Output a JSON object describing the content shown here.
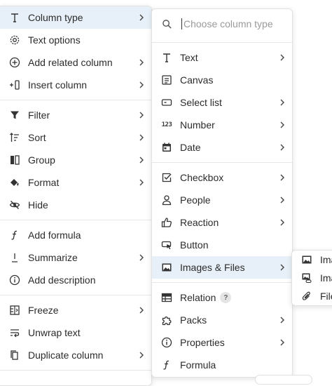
{
  "menu1": {
    "items": [
      {
        "label": "Column type",
        "icon": "column-type-icon"
      },
      {
        "label": "Text options",
        "icon": "gear-icon"
      },
      {
        "label": "Add related column",
        "icon": "plus-circle-icon"
      },
      {
        "label": "Insert column",
        "icon": "insert-column-icon"
      },
      {
        "label": "Filter",
        "icon": "filter-icon"
      },
      {
        "label": "Sort",
        "icon": "sort-icon"
      },
      {
        "label": "Group",
        "icon": "group-icon"
      },
      {
        "label": "Format",
        "icon": "paint-bucket-icon"
      },
      {
        "label": "Hide",
        "icon": "eye-slash-icon"
      },
      {
        "label": "Add formula",
        "icon": "formula-icon"
      },
      {
        "label": "Summarize",
        "icon": "summarize-icon"
      },
      {
        "label": "Add description",
        "icon": "info-icon"
      },
      {
        "label": "Freeze",
        "icon": "freeze-icon"
      },
      {
        "label": "Unwrap text",
        "icon": "unwrap-text-icon"
      },
      {
        "label": "Duplicate column",
        "icon": "duplicate-icon"
      }
    ]
  },
  "menu2": {
    "search_placeholder": "Choose column type",
    "items": [
      {
        "label": "Text",
        "icon": "text-icon"
      },
      {
        "label": "Canvas",
        "icon": "canvas-icon"
      },
      {
        "label": "Select list",
        "icon": "select-list-icon"
      },
      {
        "label": "Number",
        "icon": "number-icon",
        "glyph": "123"
      },
      {
        "label": "Date",
        "icon": "calendar-icon"
      },
      {
        "label": "Checkbox",
        "icon": "checkbox-icon"
      },
      {
        "label": "People",
        "icon": "person-icon"
      },
      {
        "label": "Reaction",
        "icon": "thumbs-up-icon"
      },
      {
        "label": "Button",
        "icon": "button-icon"
      },
      {
        "label": "Images & Files",
        "icon": "image-icon"
      },
      {
        "label": "Relation",
        "icon": "table-icon",
        "badge": "?"
      },
      {
        "label": "Packs",
        "icon": "puzzle-icon"
      },
      {
        "label": "Properties",
        "icon": "info-icon"
      },
      {
        "label": "Formula",
        "icon": "formula-icon"
      }
    ]
  },
  "menu3": {
    "items": [
      {
        "label": "Ima",
        "icon": "image-icon"
      },
      {
        "label": "Ima",
        "icon": "image-link-icon"
      },
      {
        "label": "File",
        "icon": "paperclip-icon"
      }
    ]
  }
}
